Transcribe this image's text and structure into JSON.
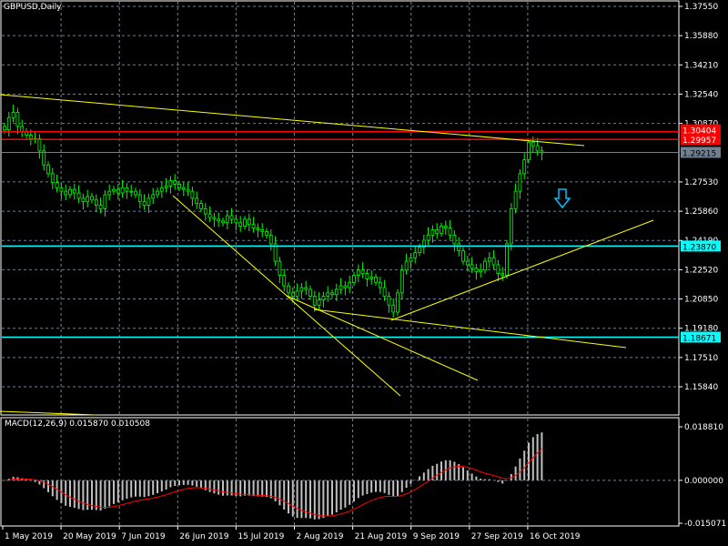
{
  "chart_data": {
    "type": "candlestick",
    "title": "GBPUSD,Daily",
    "symbol": "GBPUSD",
    "timeframe": "Daily",
    "ylim": [
      1.1584,
      1.3755
    ],
    "y_ticks": [
      "1.37550",
      "1.35880",
      "1.34210",
      "1.32540",
      "1.30870",
      "1.27530",
      "1.25860",
      "1.24190",
      "1.22520",
      "1.20850",
      "1.19180",
      "1.17510",
      "1.15840"
    ],
    "x_ticks": [
      "1 May 2019",
      "20 May 2019",
      "7 Jun 2019",
      "26 Jun 2019",
      "15 Jul 2019",
      "2 Aug 2019",
      "21 Aug 2019",
      "9 Sep 2019",
      "27 Sep 2019",
      "16 Oct 2019"
    ],
    "closes": [
      1.305,
      1.312,
      1.315,
      1.307,
      1.304,
      1.302,
      1.3,
      1.3,
      1.293,
      1.285,
      1.28,
      1.275,
      1.272,
      1.27,
      1.268,
      1.271,
      1.269,
      1.266,
      1.264,
      1.267,
      1.265,
      1.262,
      1.26,
      1.268,
      1.27,
      1.271,
      1.269,
      1.272,
      1.27,
      1.27,
      1.268,
      1.264,
      1.262,
      1.266,
      1.268,
      1.27,
      1.272,
      1.273,
      1.276,
      1.274,
      1.272,
      1.271,
      1.27,
      1.266,
      1.263,
      1.26,
      1.257,
      1.255,
      1.254,
      1.253,
      1.252,
      1.256,
      1.254,
      1.252,
      1.25,
      1.254,
      1.251,
      1.249,
      1.248,
      1.247,
      1.245,
      1.24,
      1.23,
      1.222,
      1.216,
      1.212,
      1.21,
      1.213,
      1.215,
      1.214,
      1.21,
      1.205,
      1.208,
      1.21,
      1.212,
      1.211,
      1.214,
      1.216,
      1.215,
      1.218,
      1.222,
      1.225,
      1.223,
      1.22,
      1.221,
      1.218,
      1.215,
      1.21,
      1.205,
      1.201,
      1.212,
      1.225,
      1.23,
      1.232,
      1.235,
      1.238,
      1.242,
      1.245,
      1.248,
      1.246,
      1.25,
      1.249,
      1.245,
      1.24,
      1.236,
      1.23,
      1.228,
      1.226,
      1.224,
      1.225,
      1.23,
      1.232,
      1.228,
      1.223,
      1.222,
      1.24,
      1.26,
      1.27,
      1.28,
      1.288,
      1.298,
      1.296,
      1.293,
      1.292
    ],
    "levels": [
      {
        "label": "1.30404",
        "price": 1.30404,
        "color": "#ff0000"
      },
      {
        "label": "1.29957",
        "price": 1.29957,
        "color": "#ff0000"
      },
      {
        "label": "1.29215",
        "price": 1.29215,
        "color": "#708090"
      },
      {
        "label": "1.23870",
        "price": 1.2387,
        "color": "#00ffff"
      },
      {
        "label": "1.18671",
        "price": 1.18671,
        "color": "#00ffff"
      }
    ],
    "macd": {
      "label": "MACD(12,26,9) 0.015870 0.010508",
      "ylim": [
        -0.015071,
        0.01881
      ],
      "y_ticks": [
        "0.018810",
        "0.000000",
        "-0.015071"
      ],
      "histogram_color": "#c0c0c0",
      "signal_color": "#ff0000"
    },
    "colors": {
      "background": "#000000",
      "candle": "#00ff00",
      "trendline": "#ffff00",
      "grid": "#708090",
      "arrow": "#1e90ff"
    }
  }
}
